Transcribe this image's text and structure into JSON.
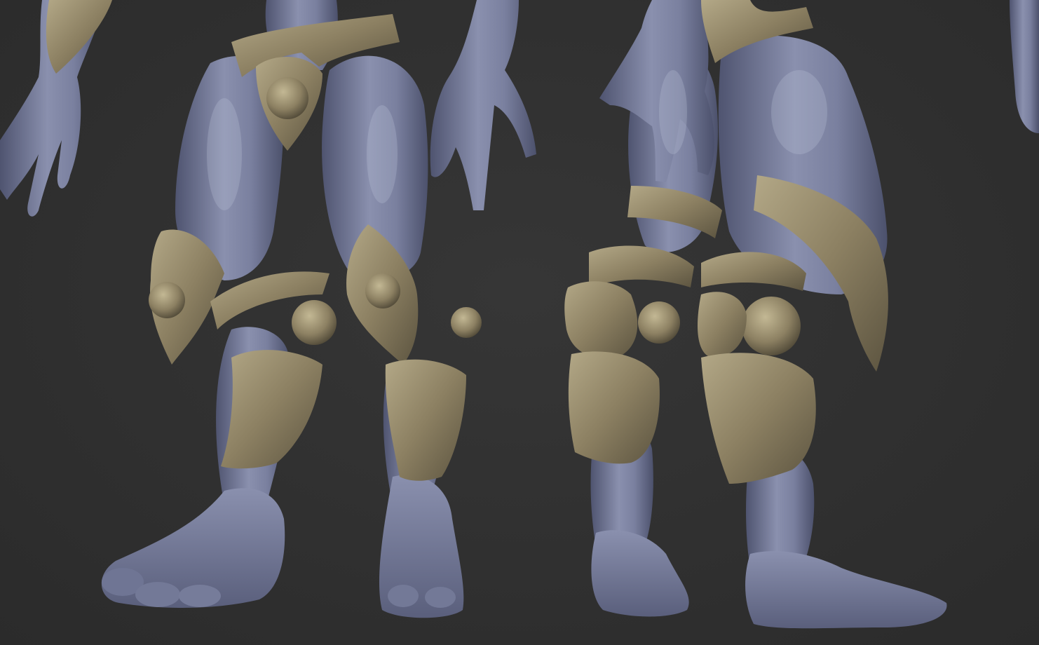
{
  "scene": {
    "kind": "3d-sculpt-render",
    "views": [
      "front",
      "back"
    ],
    "colors": {
      "background": "#303030",
      "skin": "#7e84a3",
      "skin_shadow": "#4f5470",
      "skin_highlight": "#a2a8c4",
      "armor": "#8c8062",
      "armor_shadow": "#5c5440",
      "armor_highlight": "#b3a887"
    }
  }
}
